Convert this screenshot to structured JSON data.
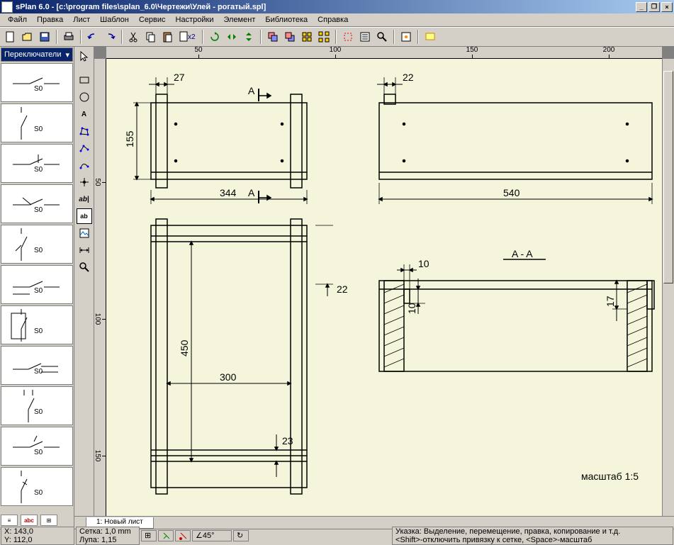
{
  "title": "sPlan 6.0 - [c:\\program files\\splan_6.0\\Чертежи\\Улей - рогатый.spl]",
  "menu": [
    "Файл",
    "Правка",
    "Лист",
    "Шаблон",
    "Сервис",
    "Настройки",
    "Элемент",
    "Библиотека",
    "Справка"
  ],
  "library_name": "Переключатели",
  "library_items": [
    "S0",
    "S0",
    "S0",
    "S0",
    "S0",
    "S0",
    "S0",
    "S0",
    "S0",
    "S0",
    "S0"
  ],
  "ruler_top": [
    "50",
    "100",
    "150",
    "200"
  ],
  "ruler_left": [
    "50",
    "100",
    "150"
  ],
  "tab_name": "1: Новый лист",
  "drawing": {
    "d27": "27",
    "d155": "155",
    "d344": "344",
    "dA1": "A",
    "dA2": "A",
    "d22a": "22",
    "d540": "540",
    "d10a": "10",
    "d10b": "10",
    "d17": "17",
    "sectAA": "A - A",
    "d22b": "22",
    "d450": "450",
    "d300": "300",
    "d23": "23",
    "scale": "масштаб  1:5"
  },
  "status": {
    "x": "X: 143,0",
    "y": "Y: 112,0",
    "grid": "Сетка: 1,0 mm",
    "zoom": "Лупа: 1,15",
    "angle": "45°",
    "hint": "Указка: Выделение, перемещение, правка, копирование и т.д.",
    "hint2": "<Shift>-отключить привязку к сетке, <Sрасе>-масштаб"
  },
  "x2": "x2"
}
